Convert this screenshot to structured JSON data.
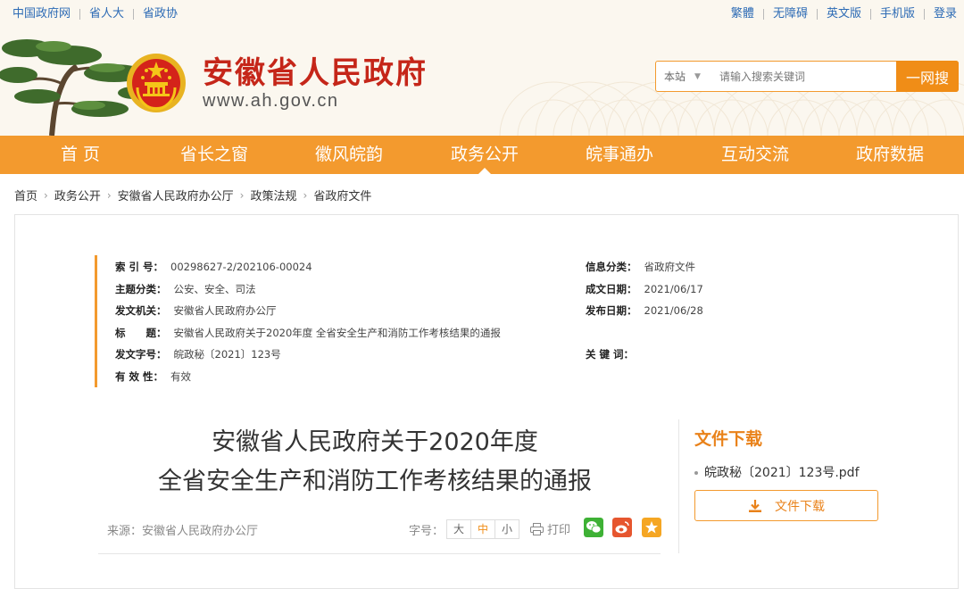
{
  "topbar": {
    "left_links": [
      "中国政府网",
      "省人大",
      "省政协"
    ],
    "right_links": [
      "繁體",
      "无障碍",
      "英文版",
      "手机版",
      "登录"
    ]
  },
  "header": {
    "site_title": "安徽省人民政府",
    "site_url": "www.ah.gov.cn"
  },
  "search": {
    "scope": "本站",
    "placeholder": "请输入搜索关键词",
    "button": "一网搜"
  },
  "nav": {
    "items": [
      "首 页",
      "省长之窗",
      "徽风皖韵",
      "政务公开",
      "皖事通办",
      "互动交流",
      "政府数据"
    ],
    "active": "政务公开"
  },
  "breadcrumb": [
    "首页",
    "政务公开",
    "安徽省人民政府办公厅",
    "政策法规",
    "省政府文件"
  ],
  "meta": {
    "index_label": "索 引 号：",
    "index_value": "00298627-2/202106-00024",
    "category_label": "信息分类：",
    "category_value": "省政府文件",
    "topic_label": "主题分类：",
    "topic_value": "公安、安全、司法",
    "created_label": "成文日期：",
    "created_value": "2021/06/17",
    "issuer_label": "发文机关：",
    "issuer_value": "安徽省人民政府办公厅",
    "published_label": "发布日期：",
    "published_value": "2021/06/28",
    "title_label": "标　　题：",
    "title_value": "安徽省人民政府关于2020年度 全省安全生产和消防工作考核结果的通报",
    "docno_label": "发文字号：",
    "docno_value": "皖政秘〔2021〕123号",
    "keywords_label": "关 键 词：",
    "keywords_value": "",
    "validity_label": "有 效 性：",
    "validity_value": "有效"
  },
  "article": {
    "title_line1": "安徽省人民政府关于2020年度",
    "title_line2": "全省安全生产和消防工作考核结果的通报",
    "source": "来源：安徽省人民政府办公厅",
    "fontsize_label": "字号：",
    "fontsize_options": [
      "大",
      "中",
      "小"
    ],
    "print_label": "打印"
  },
  "download": {
    "title": "文件下载",
    "file_name": "皖政秘〔2021〕123号.pdf",
    "button": "文件下载"
  },
  "colors": {
    "accent": "#f39a2e",
    "title_red": "#c52619",
    "link_blue": "#2d6bb5",
    "wechat": "#3eb135",
    "weibo": "#e6562f",
    "favorite": "#f5a623"
  }
}
